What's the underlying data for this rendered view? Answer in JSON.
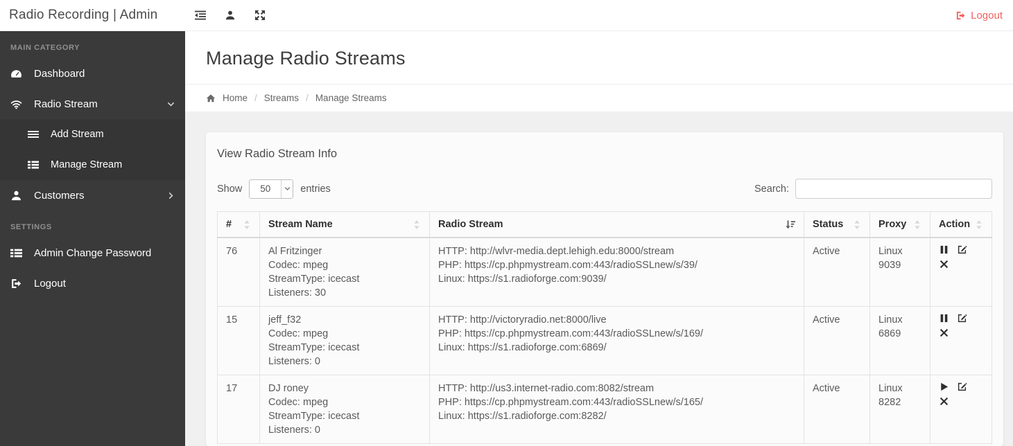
{
  "header": {
    "brand": "Radio Recording | Admin",
    "logout_label": "Logout"
  },
  "sidebar": {
    "main_section_label": "MAIN CATEGORY",
    "settings_section_label": "SETTINGS",
    "items": {
      "dashboard": "Dashboard",
      "radio_stream": "Radio Stream",
      "add_stream": "Add Stream",
      "manage_stream": "Manage Stream",
      "customers": "Customers",
      "admin_change_password": "Admin Change Password",
      "logout": "Logout"
    }
  },
  "page": {
    "title": "Manage Radio Streams",
    "breadcrumb": {
      "home": "Home",
      "streams": "Streams",
      "current": "Manage Streams",
      "separator": "/"
    }
  },
  "card": {
    "title": "View Radio Stream Info",
    "show_label": "Show",
    "entries_label": "entries",
    "page_length": "50",
    "search_label": "Search:",
    "search_value": ""
  },
  "table": {
    "columns": [
      "#",
      "Stream Name",
      "Radio Stream",
      "Status",
      "Proxy",
      "Action"
    ],
    "sorted_column": "Radio Stream",
    "sort_direction": "desc",
    "rows": [
      {
        "id": "76",
        "name": "Al Fritzinger",
        "codec": "Codec: mpeg",
        "stream_type": "StreamType: icecast",
        "listeners": "Listeners: 30",
        "http": "HTTP: http://wlvr-media.dept.lehigh.edu:8000/stream",
        "php": "PHP: https://cp.phpmystream.com:443/radioSSLnew/s/39/",
        "linux": "Linux: https://s1.radioforge.com:9039/",
        "status": "Active",
        "proxy_os": "Linux",
        "proxy_port": "9039",
        "play_state": "pause"
      },
      {
        "id": "15",
        "name": "jeff_f32",
        "codec": "Codec: mpeg",
        "stream_type": "StreamType: icecast",
        "listeners": "Listeners: 0",
        "http": "HTTP: http://victoryradio.net:8000/live",
        "php": "PHP: https://cp.phpmystream.com:443/radioSSLnew/s/169/",
        "linux": "Linux: https://s1.radioforge.com:6869/",
        "status": "Active",
        "proxy_os": "Linux",
        "proxy_port": "6869",
        "play_state": "pause"
      },
      {
        "id": "17",
        "name": "DJ roney",
        "codec": "Codec: mpeg",
        "stream_type": "StreamType: icecast",
        "listeners": "Listeners: 0",
        "http": "HTTP: http://us3.internet-radio.com:8082/stream",
        "php": "PHP: https://cp.phpmystream.com:443/radioSSLnew/s/165/",
        "linux": "Linux: https://s1.radioforge.com:8282/",
        "status": "Active",
        "proxy_os": "Linux",
        "proxy_port": "8282",
        "play_state": "play"
      }
    ]
  },
  "icons": {
    "menu_toggle": "outdent-icon",
    "profile": "user-icon",
    "fullscreen": "arrows-expand-icon",
    "logout": "sign-out-icon",
    "dashboard": "tachometer-icon",
    "radio_stream": "wifi-icon",
    "add_stream": "list-icon",
    "manage_stream": "th-list-icon",
    "customers": "user-icon",
    "admin_change_password": "th-list-icon",
    "breadcrumb_home": "home-icon",
    "sort_inactive": "sort-both-arrows-icon",
    "sort_active": "sort-amount-desc-icon",
    "pause": "pause-icon",
    "play": "play-icon",
    "edit": "edit-icon",
    "delete": "x-icon",
    "expand_open": "chevron-down-icon",
    "expand_closed": "chevron-right-icon",
    "select_arrow": "chevron-down-icon"
  },
  "colors": {
    "logout_red": "#f0625d",
    "status_active_green": "#34dd34",
    "sidebar_bg": "#3a3a3a",
    "submenu_bg": "#353535",
    "content_bg": "#f0f0f0",
    "card_bg": "#fbfbfb"
  }
}
